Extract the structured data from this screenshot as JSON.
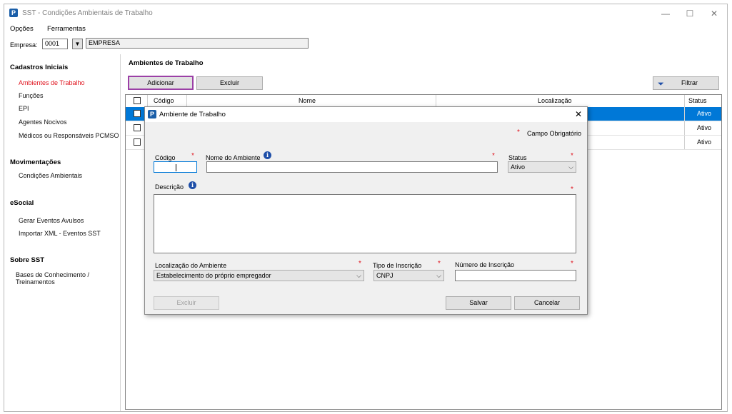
{
  "window": {
    "title": "SST - Condições Ambientais de Trabalho",
    "minimize": "—",
    "maximize": "☐",
    "close": "✕"
  },
  "menu": [
    "Opções",
    "Ferramentas"
  ],
  "empresa": {
    "label": "Empresa:",
    "code": "0001",
    "dropdown": "▼",
    "name": "EMPRESA"
  },
  "sidebar": {
    "sections": [
      {
        "title": "Cadastros Iniciais",
        "items": [
          "Ambientes de Trabalho",
          "Funções",
          "EPI",
          "Agentes Nocivos",
          "Médicos ou Responsáveis PCMSO"
        ]
      },
      {
        "title": "Movimentações",
        "items": [
          "Condições Ambientais"
        ]
      },
      {
        "title": "eSocial",
        "items": [
          "Gerar Eventos Avulsos",
          "Importar XML - Eventos SST"
        ]
      },
      {
        "title": "Sobre SST",
        "items": [
          "Bases de Conhecimento /",
          "Treinamentos"
        ]
      }
    ],
    "active_item": "Ambientes de Trabalho"
  },
  "main": {
    "title": "Ambientes de Trabalho",
    "add_button": "Adicionar",
    "delete_button": "Excluir",
    "filter_button": "Filtrar",
    "columns": [
      "Código",
      "Nome",
      "Localização",
      "Status"
    ],
    "rows": [
      {
        "status": "Ativo",
        "selected": true
      },
      {
        "status": "Ativo",
        "selected": false
      },
      {
        "status": "Ativo",
        "selected": false
      }
    ]
  },
  "dialog": {
    "title": "Ambiente de Trabalho",
    "close": "✕",
    "required_note": "Campo Obrigatório",
    "required_mark": "*",
    "codigo_label": "Código",
    "codigo_value": "",
    "nome_label": "Nome do Ambiente",
    "nome_value": "",
    "status_label": "Status",
    "status_value": "Ativo",
    "descricao_label": "Descrição",
    "descricao_value": "",
    "localizacao_label": "Localização do Ambiente",
    "localizacao_value": "Estabelecimento do próprio empregador",
    "tipo_inscricao_label": "Tipo de Inscrição",
    "tipo_inscricao_value": "CNPJ",
    "numero_inscricao_label": "Número de Inscrição",
    "numero_inscricao_value": "",
    "excluir_button": "Excluir",
    "salvar_button": "Salvar",
    "cancelar_button": "Cancelar",
    "info_glyph": "i"
  },
  "colors": {
    "accent": "#0078d7",
    "active_link": "#e0141e",
    "highlight_border": "#9b3fa6",
    "app_icon": "#1a5ea8"
  }
}
